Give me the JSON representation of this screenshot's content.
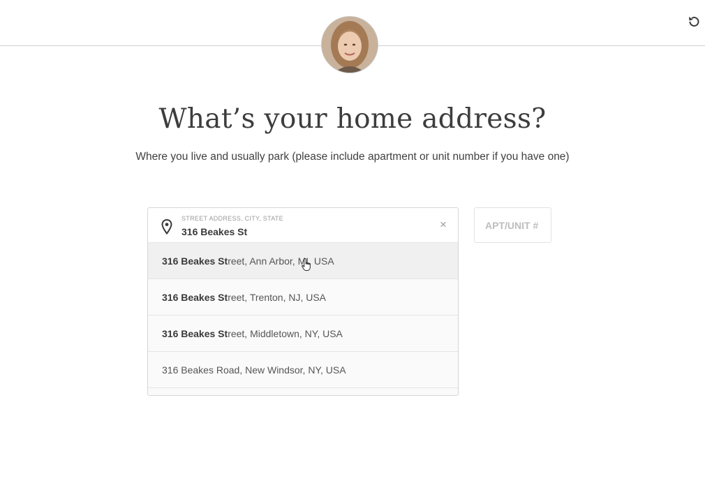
{
  "header": {
    "avatar_icon": "user-avatar-photo",
    "reset_icon": "undo-icon"
  },
  "main": {
    "title": "What’s your home address?",
    "subtitle": "Where you live and usually park (please include apartment or unit number if you have one)"
  },
  "address_field": {
    "label": "STREET ADDRESS, CITY, STATE",
    "value": "316 Beakes St",
    "icon": "location-pin-icon",
    "clear_label": "×"
  },
  "apt_field": {
    "placeholder": "APT/UNIT #"
  },
  "suggestions": [
    {
      "match": "316 Beakes St",
      "rest": "reet, Ann Arbor, MI, USA"
    },
    {
      "match": "316 Beakes St",
      "rest": "reet, Trenton, NJ, USA"
    },
    {
      "match": "316 Beakes St",
      "rest": "reet, Middletown, NY, USA"
    },
    {
      "match": "",
      "rest": "316 Beakes Road, New Windsor, NY, USA"
    }
  ],
  "colors": {
    "title": "#3d3d3d",
    "border": "#d6d6d6",
    "placeholder": "#bdbdbd"
  }
}
